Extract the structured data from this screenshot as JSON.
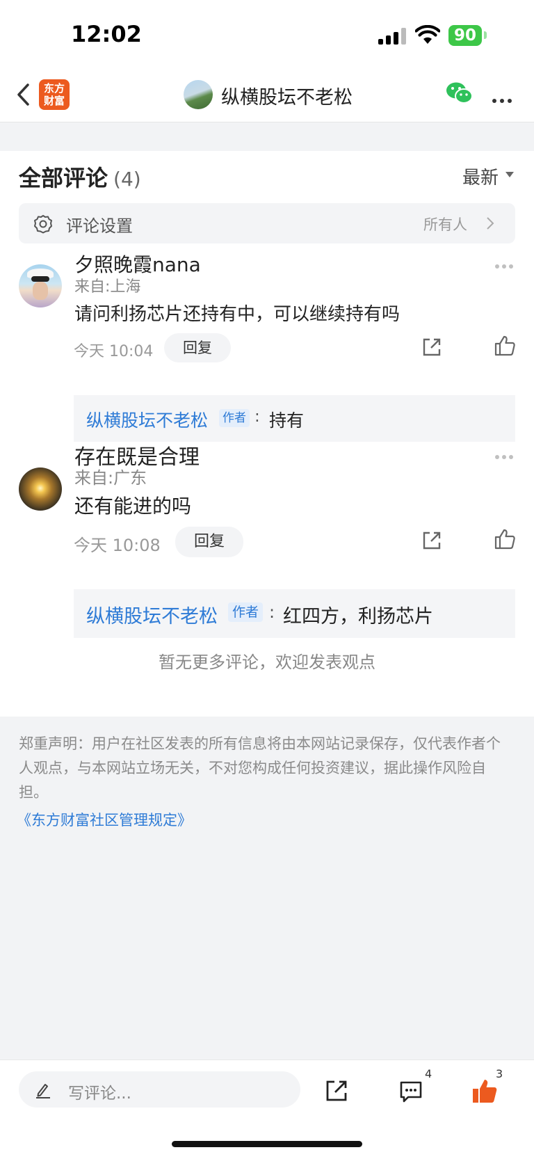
{
  "status_bar": {
    "time": "12:02",
    "battery": "90"
  },
  "nav": {
    "logo_line1": "东方",
    "logo_line2": "财富",
    "title": "纵横股坛不老松"
  },
  "comments_section": {
    "title": "全部评论",
    "count": "(4)",
    "sort_label": "最新",
    "settings_label": "评论设置",
    "settings_value": "所有人"
  },
  "comments": [
    {
      "username": "夕照晚霞nana",
      "location": "来自:上海",
      "text": "请问利扬芯片还持有中，可以继续持有吗",
      "time": "今天 10:04",
      "reply_label": "回复",
      "author_reply": {
        "author": "纵横股坛不老松",
        "badge": "作者",
        "colon": ":",
        "text": "持有"
      }
    },
    {
      "username": "存在既是合理",
      "location": "来自:广东",
      "text": "还有能进的吗",
      "time": "今天 10:08",
      "reply_label": "回复",
      "author_reply": {
        "author": "纵横股坛不老松",
        "badge": "作者",
        "colon": ":",
        "text": "红四方，利扬芯片"
      }
    }
  ],
  "no_more": "暂无更多评论，欢迎发表观点",
  "disclaimer": {
    "text": "郑重声明：用户在社区发表的所有信息将由本网站记录保存，仅代表作者个人观点，与本网站立场无关，不对您构成任何投资建议，据此操作风险自担。",
    "link": "《东方财富社区管理规定》"
  },
  "bottom_bar": {
    "placeholder": "写评论...",
    "comment_count": "4",
    "like_count": "3"
  },
  "colors": {
    "brand": "#ec5a1f",
    "link": "#2e7bd6",
    "like": "#ec5a1f",
    "battery": "#3dc748",
    "wechat": "#2fc15b"
  }
}
